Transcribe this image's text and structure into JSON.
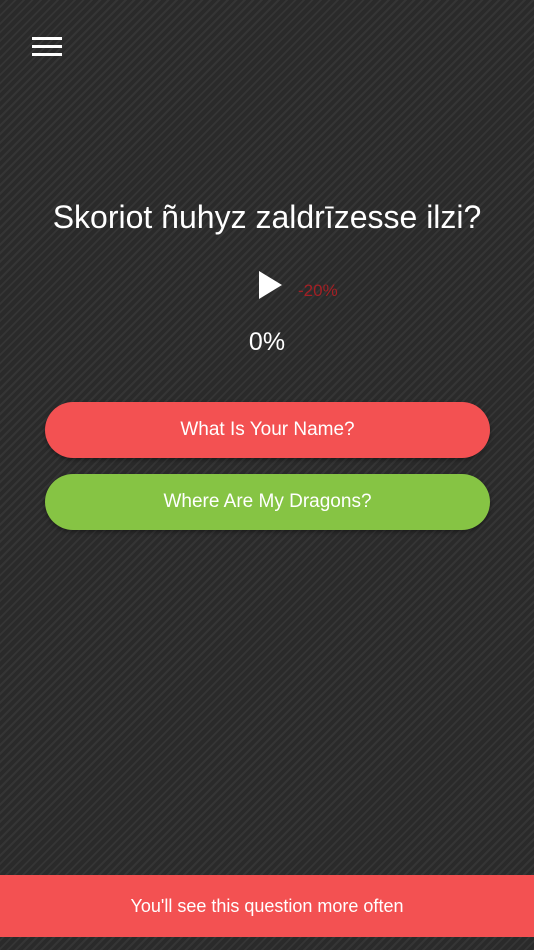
{
  "header": {
    "menu_icon": "hamburger-menu-icon"
  },
  "question": {
    "text": "Skoriot ñuhyz zaldrīzesse ilzi?"
  },
  "audio": {
    "play_icon": "play-icon",
    "speed_label": "-20%"
  },
  "progress": {
    "text": "0%"
  },
  "answers": [
    {
      "label": "What Is Your Name?",
      "color": "#f35152"
    },
    {
      "label": "Where Are My Dragons?",
      "color": "#86c444"
    }
  ],
  "toast": {
    "message": "You'll see this question more often",
    "color": "#f35152"
  },
  "colors": {
    "background": "#2c2c2c",
    "speed_label": "#a31f24"
  }
}
